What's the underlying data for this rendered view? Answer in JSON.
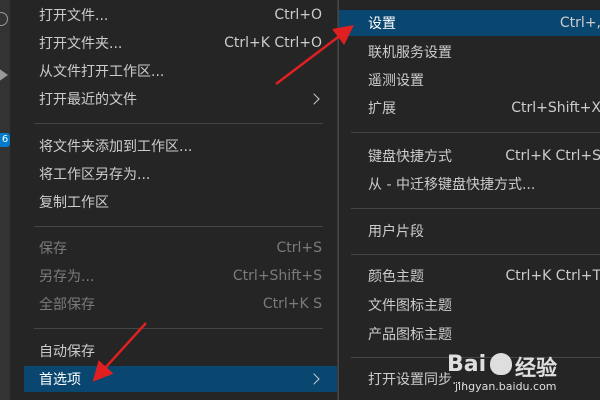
{
  "activity_bar": {
    "badge": "6"
  },
  "menu": {
    "items": [
      {
        "label": "打开文件...",
        "accel": "Ctrl+O"
      },
      {
        "label": "打开文件夹...",
        "accel": "Ctrl+K Ctrl+O"
      },
      {
        "label": "从文件打开工作区...",
        "accel": ""
      },
      {
        "label": "打开最近的文件",
        "accel": ""
      },
      {
        "label": "将文件夹添加到工作区...",
        "accel": ""
      },
      {
        "label": "将工作区另存为...",
        "accel": ""
      },
      {
        "label": "复制工作区",
        "accel": ""
      },
      {
        "label": "保存",
        "accel": "Ctrl+S"
      },
      {
        "label": "另存为...",
        "accel": "Ctrl+Shift+S"
      },
      {
        "label": "全部保存",
        "accel": "Ctrl+K S"
      },
      {
        "label": "自动保存",
        "accel": ""
      },
      {
        "label": "首选项",
        "accel": ""
      }
    ]
  },
  "submenu": {
    "items": [
      {
        "label": "设置",
        "accel": "Ctrl+,"
      },
      {
        "label": "联机服务设置",
        "accel": ""
      },
      {
        "label": "遥测设置",
        "accel": ""
      },
      {
        "label": "扩展",
        "accel": "Ctrl+Shift+X"
      },
      {
        "label": "键盘快捷方式",
        "accel": "Ctrl+K Ctrl+S"
      },
      {
        "label": "从 - 中迁移键盘快捷方式...",
        "accel": ""
      },
      {
        "label": "用户片段",
        "accel": ""
      },
      {
        "label": "颜色主题",
        "accel": "Ctrl+K Ctrl+T"
      },
      {
        "label": "文件图标主题",
        "accel": ""
      },
      {
        "label": "产品图标主题",
        "accel": ""
      },
      {
        "label": "打开设置同步...",
        "accel": ""
      }
    ]
  },
  "colors": {
    "menu_bg": "#252526",
    "selection": "#094771",
    "arrow": "#e02020"
  },
  "watermark": {
    "logo_text": "Bai",
    "logo_suffix": "经验",
    "url": "jingyan.baidu.com"
  }
}
